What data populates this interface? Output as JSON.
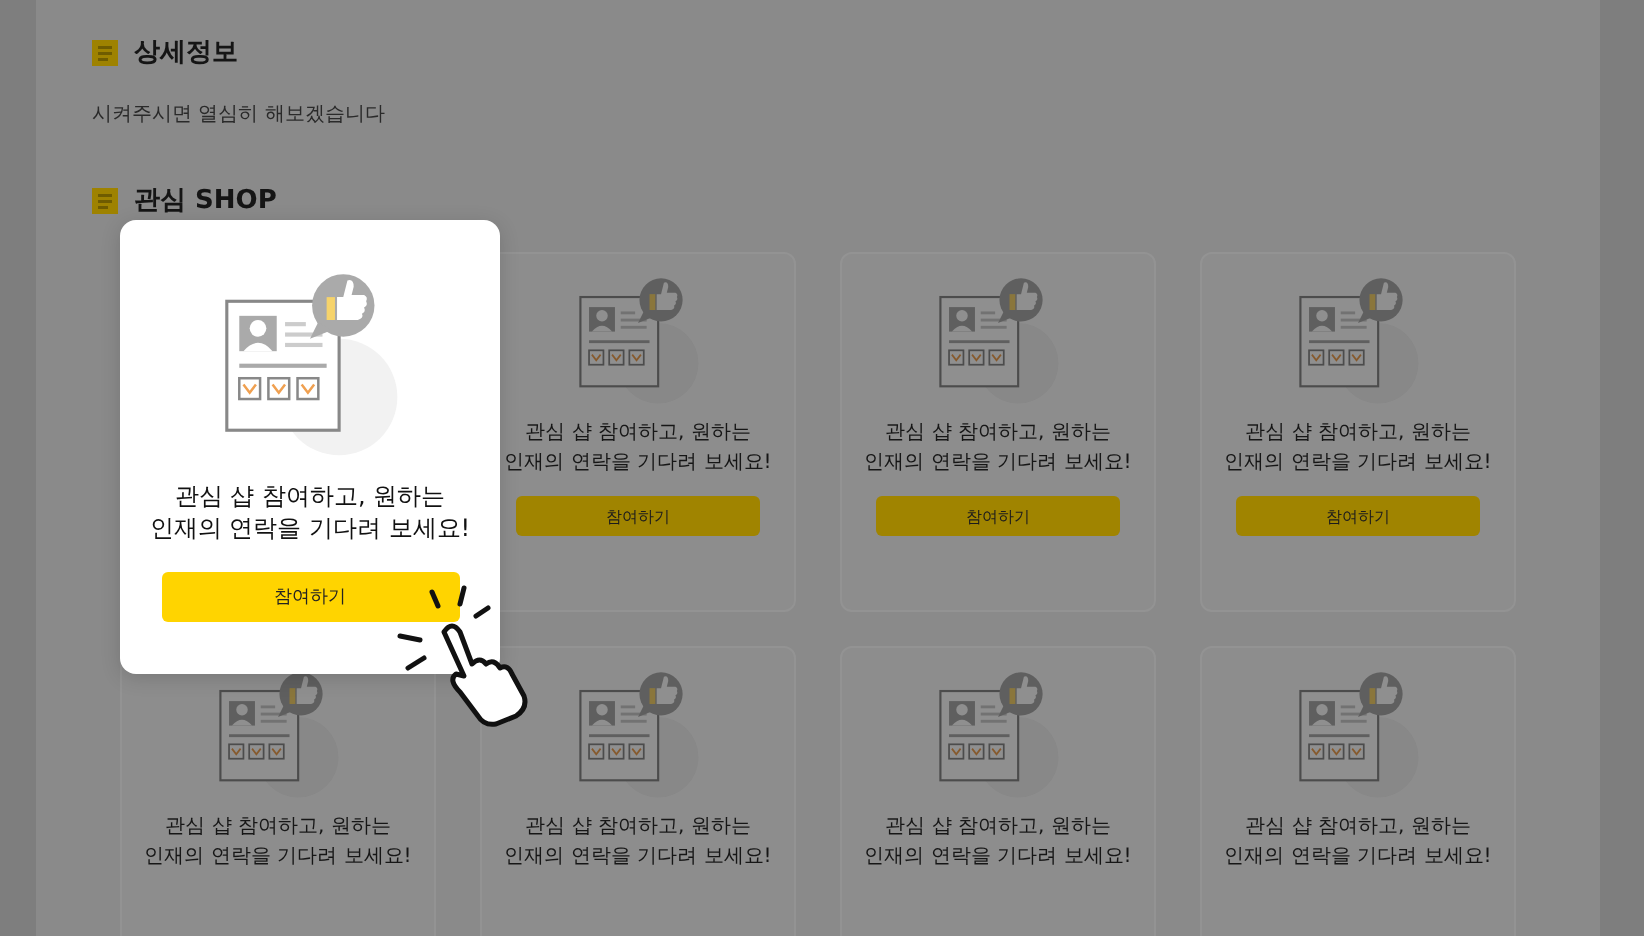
{
  "details": {
    "heading": "상세정보",
    "text": "시켜주시면 열심히 해보겠습니다"
  },
  "interest_shop": {
    "heading": "관심 SHOP",
    "popup": {
      "message": [
        "관심 샵 참여하고, 원하는",
        "인재의 연락을 기다려 보세요!"
      ],
      "button": "참여하기"
    },
    "cards": [
      {
        "message": [
          "관심 샵 참여하고, 원하는",
          "인재의 연락을 기다려 보세요!"
        ],
        "button": "참여하기"
      },
      {
        "message": [
          "관심 샵 참여하고, 원하는",
          "인재의 연락을 기다려 보세요!"
        ],
        "button": "참여하기"
      },
      {
        "message": [
          "관심 샵 참여하고, 원하는",
          "인재의 연락을 기다려 보세요!"
        ],
        "button": "참여하기"
      },
      {
        "message": [
          "관심 샵 참여하고, 원하는",
          "인재의 연락을 기다려 보세요!"
        ]
      },
      {
        "message": [
          "관심 샵 참여하고, 원하는",
          "인재의 연락을 기다려 보세요!"
        ]
      },
      {
        "message": [
          "관심 샵 참여하고, 원하는",
          "인재의 연락을 기다려 보세요!"
        ]
      },
      {
        "message": [
          "관심 샵 참여하고, 원하는",
          "인재의 연락을 기다려 보세요!"
        ]
      }
    ]
  }
}
